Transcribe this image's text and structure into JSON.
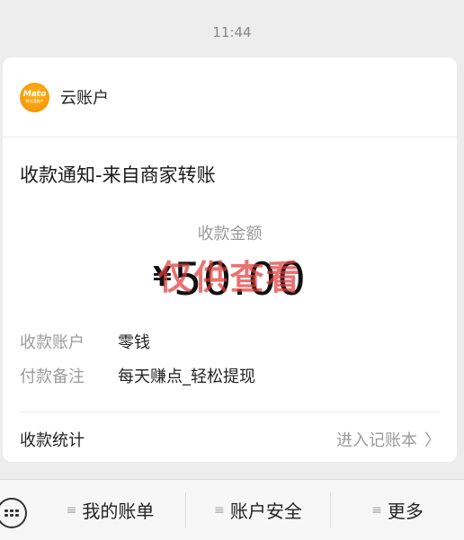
{
  "header": {
    "time": "11:44"
  },
  "card": {
    "logo": {
      "main": "Mato",
      "sub": "财付通商户"
    },
    "account_name": "云账户",
    "notice_title": "收款通知-来自商家转账",
    "amount_label": "收款金额",
    "currency": "¥",
    "amount": "50.00",
    "watermark": "仅供查看",
    "details": [
      {
        "key": "收款账户",
        "value": "零钱"
      },
      {
        "key": "付款备注",
        "value": "每天赚点_轻松提现"
      }
    ],
    "stats_label": "收款统计",
    "stats_link": "进入记账本",
    "stats_chevron": "〉"
  },
  "bottom_menu": {
    "keyboard_icon": "keyboard-icon",
    "items": [
      {
        "label": "我的账单",
        "icon": "≡"
      },
      {
        "label": "账户安全",
        "icon": "≡"
      },
      {
        "label": "更多",
        "icon": "≡"
      }
    ]
  }
}
